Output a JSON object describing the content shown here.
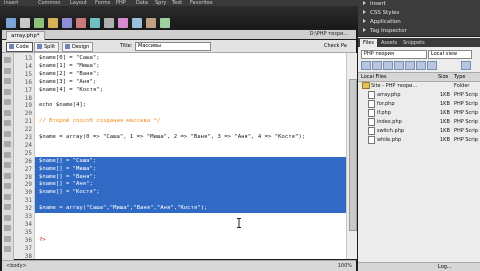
{
  "menu": {
    "items": [
      "Insert",
      "Common",
      "Layout",
      "Forms",
      "PHP",
      "Data",
      "Spry",
      "Text",
      "Favorites"
    ]
  },
  "document": {
    "tab_label": "array.php*",
    "path": "D:\\PHP тезри..."
  },
  "view_bar": {
    "code_label": "Code",
    "split_label": "Split",
    "design_label": "Design",
    "title_label": "Title:",
    "title_value": "Массивы",
    "check_page_label": "Check Pa"
  },
  "editor": {
    "lines": [
      {
        "num": "13",
        "text": "$name[0] = \"Саша\";",
        "style": "normal"
      },
      {
        "num": "14",
        "text": "$name[1] = \"Миша\";",
        "style": "normal"
      },
      {
        "num": "15",
        "text": "$name[2] = \"Ваня\";",
        "style": "normal"
      },
      {
        "num": "16",
        "text": "$name[3] = \"Аня\";",
        "style": "normal"
      },
      {
        "num": "17",
        "text": "$name[4] = \"Костя\";",
        "style": "normal"
      },
      {
        "num": "18",
        "text": "",
        "style": "normal"
      },
      {
        "num": "19",
        "text": "echo $name[4];",
        "style": "normal"
      },
      {
        "num": "20",
        "text": "",
        "style": "normal"
      },
      {
        "num": "21",
        "text": "// Второй способ создания массива */",
        "style": "comment"
      },
      {
        "num": "22",
        "text": "",
        "style": "normal"
      },
      {
        "num": "23",
        "text": "$name = array(0 => \"Саша\", 1 => \"Миша\", 2 => \"Ваня\", 3 => \"Аня\", 4 => \"Костя\");",
        "style": "normal"
      },
      {
        "num": "24",
        "text": "",
        "style": "normal"
      },
      {
        "num": "25",
        "text": "",
        "style": "normal"
      },
      {
        "num": "26",
        "text": "$name[] = \"Саша\";",
        "style": "selected"
      },
      {
        "num": "27",
        "text": "$name[] = \"Миша\";",
        "style": "selected"
      },
      {
        "num": "28",
        "text": "$name[] = \"Ваня\";",
        "style": "selected"
      },
      {
        "num": "29",
        "text": "$name[] = \"Аня\";",
        "style": "selected"
      },
      {
        "num": "30",
        "text": "$name[] = \"Костя\";",
        "style": "selected"
      },
      {
        "num": "31",
        "text": "",
        "style": "selected"
      },
      {
        "num": "32",
        "text": "$name = array(\"Саша\",\"Миша\",\"Ваня\",\"Аня\",\"Костя\");",
        "style": "selected"
      },
      {
        "num": "33",
        "text": "",
        "style": "normal"
      },
      {
        "num": "34",
        "text": "",
        "style": "normal"
      },
      {
        "num": "35",
        "text": "",
        "style": "normal"
      },
      {
        "num": "36",
        "text": "?>",
        "style": "tag"
      },
      {
        "num": "37",
        "text": "",
        "style": "normal"
      },
      {
        "num": "38",
        "text": "",
        "style": "normal"
      }
    ]
  },
  "status": {
    "zoom": "100%",
    "tag": "<body>"
  },
  "right_panel": {
    "panels": [
      "Insert",
      "CSS Styles",
      "Application",
      "Tag Inspector",
      "Files"
    ],
    "files_tabs": [
      "Files",
      "Assets",
      "Snippets"
    ],
    "site_select": "PHP теория",
    "view_select": "Local view",
    "columns": {
      "name": "Local Files",
      "size": "Size",
      "type": "Type"
    },
    "files": [
      {
        "name": "Site - PHP теори...",
        "size": "",
        "type": "Folder",
        "kind": "folder"
      },
      {
        "name": "array.php",
        "size": "1KB",
        "type": "PHP Scrip",
        "kind": "file"
      },
      {
        "name": "for.php",
        "size": "1KB",
        "type": "PHP Scrip",
        "kind": "file"
      },
      {
        "name": "if.php",
        "size": "1KB",
        "type": "PHP Scrip",
        "kind": "file"
      },
      {
        "name": "index.php",
        "size": "1KB",
        "type": "PHP Scrip",
        "kind": "file"
      },
      {
        "name": "switch.php",
        "size": "1KB",
        "type": "PHP Scrip",
        "kind": "file"
      },
      {
        "name": "while.php",
        "size": "1KB",
        "type": "PHP Scrip",
        "kind": "file"
      }
    ],
    "bottom_log": "Log..."
  },
  "colors": {
    "selection": "#316ac5",
    "comment": "#f08a18",
    "tag": "#d40000"
  }
}
